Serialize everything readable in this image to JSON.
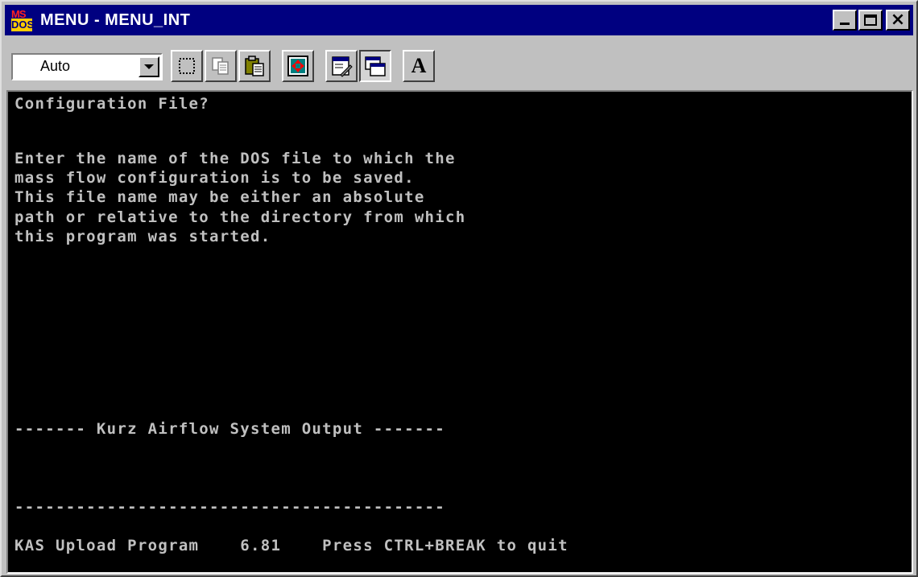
{
  "window": {
    "title": "MENU - MENU_INT",
    "icon_label_top": "MS",
    "icon_label_bottom": "DOS"
  },
  "toolbar": {
    "font_size_value": "Auto",
    "tools": [
      "mark-icon",
      "copy-icon",
      "paste-icon",
      "fullscreen-icon",
      "properties-icon",
      "background-icon",
      "font-icon"
    ],
    "font_button_label": "A"
  },
  "console": {
    "prompt_title": "Configuration File?",
    "help_lines": [
      "Enter the name of the DOS file to which the",
      "mass flow configuration is to be saved.",
      "This file name may be either an absolute",
      "path or relative to the directory from which",
      "this program was started."
    ],
    "output_header": "------- Kurz Airflow System Output -------",
    "output_footer": "------------------------------------------",
    "status_line": "KAS Upload Program    6.81    Press CTRL+BREAK to quit"
  },
  "colors": {
    "titlebar": "#000080",
    "console_bg": "#000000",
    "console_text": "#c0c0c0",
    "chrome": "#c0c0c0"
  }
}
